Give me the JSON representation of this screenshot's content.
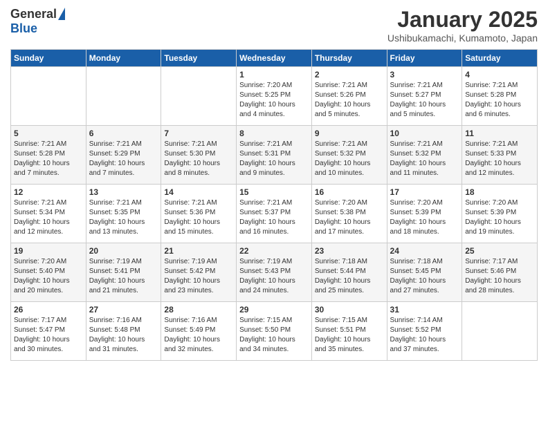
{
  "header": {
    "logo_general": "General",
    "logo_blue": "Blue",
    "month_title": "January 2025",
    "location": "Ushibukamachi, Kumamoto, Japan"
  },
  "days_of_week": [
    "Sunday",
    "Monday",
    "Tuesday",
    "Wednesday",
    "Thursday",
    "Friday",
    "Saturday"
  ],
  "weeks": [
    {
      "days": [
        {
          "num": "",
          "info": ""
        },
        {
          "num": "",
          "info": ""
        },
        {
          "num": "",
          "info": ""
        },
        {
          "num": "1",
          "info": "Sunrise: 7:20 AM\nSunset: 5:25 PM\nDaylight: 10 hours\nand 4 minutes."
        },
        {
          "num": "2",
          "info": "Sunrise: 7:21 AM\nSunset: 5:26 PM\nDaylight: 10 hours\nand 5 minutes."
        },
        {
          "num": "3",
          "info": "Sunrise: 7:21 AM\nSunset: 5:27 PM\nDaylight: 10 hours\nand 5 minutes."
        },
        {
          "num": "4",
          "info": "Sunrise: 7:21 AM\nSunset: 5:28 PM\nDaylight: 10 hours\nand 6 minutes."
        }
      ]
    },
    {
      "days": [
        {
          "num": "5",
          "info": "Sunrise: 7:21 AM\nSunset: 5:28 PM\nDaylight: 10 hours\nand 7 minutes."
        },
        {
          "num": "6",
          "info": "Sunrise: 7:21 AM\nSunset: 5:29 PM\nDaylight: 10 hours\nand 7 minutes."
        },
        {
          "num": "7",
          "info": "Sunrise: 7:21 AM\nSunset: 5:30 PM\nDaylight: 10 hours\nand 8 minutes."
        },
        {
          "num": "8",
          "info": "Sunrise: 7:21 AM\nSunset: 5:31 PM\nDaylight: 10 hours\nand 9 minutes."
        },
        {
          "num": "9",
          "info": "Sunrise: 7:21 AM\nSunset: 5:32 PM\nDaylight: 10 hours\nand 10 minutes."
        },
        {
          "num": "10",
          "info": "Sunrise: 7:21 AM\nSunset: 5:32 PM\nDaylight: 10 hours\nand 11 minutes."
        },
        {
          "num": "11",
          "info": "Sunrise: 7:21 AM\nSunset: 5:33 PM\nDaylight: 10 hours\nand 12 minutes."
        }
      ]
    },
    {
      "days": [
        {
          "num": "12",
          "info": "Sunrise: 7:21 AM\nSunset: 5:34 PM\nDaylight: 10 hours\nand 12 minutes."
        },
        {
          "num": "13",
          "info": "Sunrise: 7:21 AM\nSunset: 5:35 PM\nDaylight: 10 hours\nand 13 minutes."
        },
        {
          "num": "14",
          "info": "Sunrise: 7:21 AM\nSunset: 5:36 PM\nDaylight: 10 hours\nand 15 minutes."
        },
        {
          "num": "15",
          "info": "Sunrise: 7:21 AM\nSunset: 5:37 PM\nDaylight: 10 hours\nand 16 minutes."
        },
        {
          "num": "16",
          "info": "Sunrise: 7:20 AM\nSunset: 5:38 PM\nDaylight: 10 hours\nand 17 minutes."
        },
        {
          "num": "17",
          "info": "Sunrise: 7:20 AM\nSunset: 5:39 PM\nDaylight: 10 hours\nand 18 minutes."
        },
        {
          "num": "18",
          "info": "Sunrise: 7:20 AM\nSunset: 5:39 PM\nDaylight: 10 hours\nand 19 minutes."
        }
      ]
    },
    {
      "days": [
        {
          "num": "19",
          "info": "Sunrise: 7:20 AM\nSunset: 5:40 PM\nDaylight: 10 hours\nand 20 minutes."
        },
        {
          "num": "20",
          "info": "Sunrise: 7:19 AM\nSunset: 5:41 PM\nDaylight: 10 hours\nand 21 minutes."
        },
        {
          "num": "21",
          "info": "Sunrise: 7:19 AM\nSunset: 5:42 PM\nDaylight: 10 hours\nand 23 minutes."
        },
        {
          "num": "22",
          "info": "Sunrise: 7:19 AM\nSunset: 5:43 PM\nDaylight: 10 hours\nand 24 minutes."
        },
        {
          "num": "23",
          "info": "Sunrise: 7:18 AM\nSunset: 5:44 PM\nDaylight: 10 hours\nand 25 minutes."
        },
        {
          "num": "24",
          "info": "Sunrise: 7:18 AM\nSunset: 5:45 PM\nDaylight: 10 hours\nand 27 minutes."
        },
        {
          "num": "25",
          "info": "Sunrise: 7:17 AM\nSunset: 5:46 PM\nDaylight: 10 hours\nand 28 minutes."
        }
      ]
    },
    {
      "days": [
        {
          "num": "26",
          "info": "Sunrise: 7:17 AM\nSunset: 5:47 PM\nDaylight: 10 hours\nand 30 minutes."
        },
        {
          "num": "27",
          "info": "Sunrise: 7:16 AM\nSunset: 5:48 PM\nDaylight: 10 hours\nand 31 minutes."
        },
        {
          "num": "28",
          "info": "Sunrise: 7:16 AM\nSunset: 5:49 PM\nDaylight: 10 hours\nand 32 minutes."
        },
        {
          "num": "29",
          "info": "Sunrise: 7:15 AM\nSunset: 5:50 PM\nDaylight: 10 hours\nand 34 minutes."
        },
        {
          "num": "30",
          "info": "Sunrise: 7:15 AM\nSunset: 5:51 PM\nDaylight: 10 hours\nand 35 minutes."
        },
        {
          "num": "31",
          "info": "Sunrise: 7:14 AM\nSunset: 5:52 PM\nDaylight: 10 hours\nand 37 minutes."
        },
        {
          "num": "",
          "info": ""
        }
      ]
    }
  ]
}
